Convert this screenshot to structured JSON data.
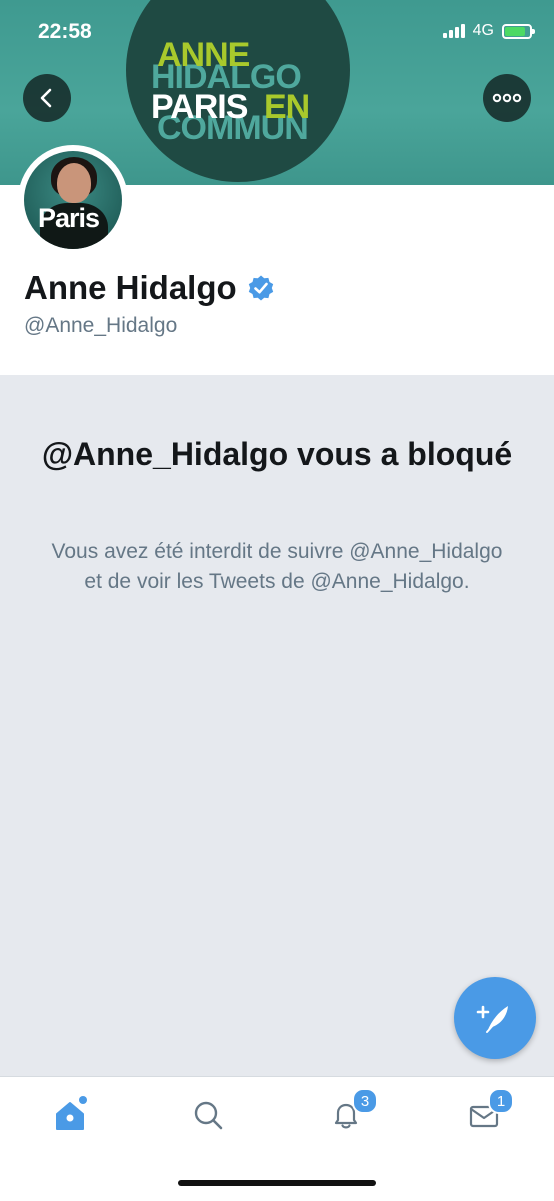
{
  "status_bar": {
    "time": "22:58",
    "network": "4G"
  },
  "banner": {
    "logo_lines": [
      "ANNE",
      "HIDALGO",
      "PARIS",
      "EN",
      "COMMUN"
    ]
  },
  "profile": {
    "avatar_text": "Paris",
    "name": "Anne Hidalgo",
    "verified": true,
    "handle": "@Anne_Hidalgo"
  },
  "blocked": {
    "title": "@Anne_Hidalgo vous a bloqué",
    "message": "Vous avez été interdit de suivre @Anne_Hidalgo et de voir les Tweets de @Anne_Hidalgo."
  },
  "tabbar": {
    "notifications_badge": "3",
    "messages_badge": "1"
  },
  "colors": {
    "accent": "#4a9ae6",
    "banner": "#3f9a90",
    "logo_green": "#a9c92c"
  },
  "icons": [
    "chevron-left-icon",
    "more-dots-icon",
    "verified-badge-icon",
    "compose-tweet-icon",
    "home-icon",
    "search-icon",
    "bell-icon",
    "mail-icon"
  ]
}
